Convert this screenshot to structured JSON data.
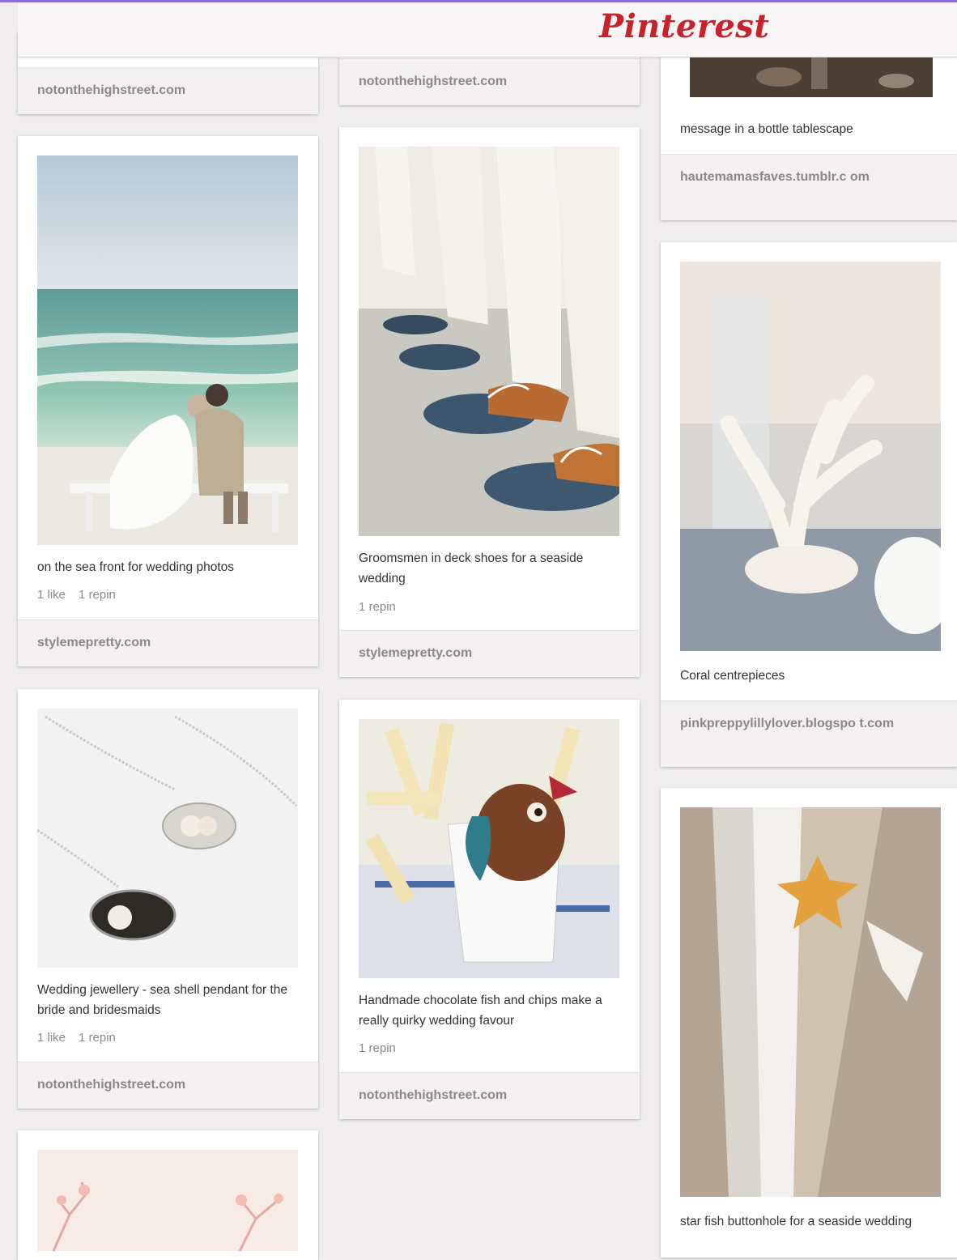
{
  "header": {
    "logo_text": "Pinterest"
  },
  "column1": {
    "pin0": {
      "source": "notonthehighstreet.com"
    },
    "pin1": {
      "image": "beach-couple-photo",
      "description": "on the sea front for wedding photos",
      "likes": "1 like",
      "repins": "1 repin",
      "source": "stylemepretty.com"
    },
    "pin2": {
      "image": "shell-pendant-necklaces-photo",
      "description": "Wedding jewellery - sea shell pendant for the bride and bridesmaids",
      "likes": "1 like",
      "repins": "1 repin",
      "source": "notonthehighstreet.com"
    },
    "pin3": {
      "image": "pink-astilbe-flowers-photo"
    }
  },
  "column2": {
    "pin0": {
      "source": "notonthehighstreet.com"
    },
    "pin1": {
      "image": "groomsmen-deck-shoes-photo",
      "description": "Groomsmen in deck shoes for a seaside wedding",
      "repins": "1 repin",
      "source": "stylemepretty.com"
    },
    "pin2": {
      "image": "chocolate-fish-and-chips-photo",
      "description": "Handmade chocolate fish and chips make a really quirky wedding favour",
      "repins": "1 repin",
      "source": "notonthehighstreet.com"
    }
  },
  "column3": {
    "pin0": {
      "image": "bottle-tablescape-photo",
      "description": "message in a bottle tablescape",
      "source": "hautemamasfaves.tumblr.c om"
    },
    "pin1": {
      "image": "coral-centrepiece-photo",
      "description": "Coral centrepieces",
      "source": "pinkpreppylillylover.blogspo t.com"
    },
    "pin2": {
      "image": "starfish-buttonhole-photo",
      "description": "star fish buttonhole for a seaside wedding"
    }
  }
}
